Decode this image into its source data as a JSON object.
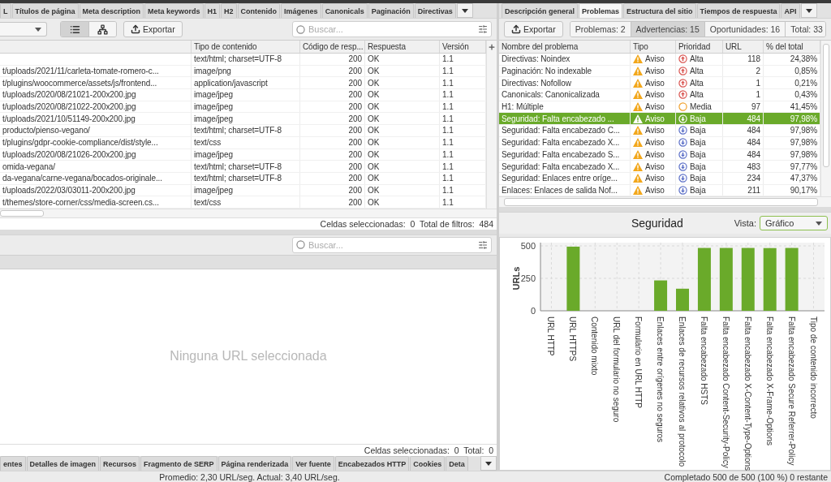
{
  "left_panel": {
    "tabs": [
      {
        "label": "L",
        "selected": false
      },
      {
        "label": "Títulos de página",
        "selected": false
      },
      {
        "label": "Meta description",
        "selected": false
      },
      {
        "label": "Meta keywords",
        "selected": false
      },
      {
        "label": "H1",
        "selected": false
      },
      {
        "label": "H2",
        "selected": false
      },
      {
        "label": "Contenido",
        "selected": false
      },
      {
        "label": "Imágenes",
        "selected": false
      },
      {
        "label": "Canonicals",
        "selected": false
      },
      {
        "label": "Paginación",
        "selected": false
      },
      {
        "label": "Directivas",
        "selected": false
      }
    ],
    "view_buttons": [
      {
        "kind": "list",
        "selected": true
      },
      {
        "kind": "tree",
        "selected": false
      }
    ],
    "export_button": "Exportar",
    "search": {
      "placeholder": "Buscar..."
    },
    "table": {
      "columns": [
        "Tipo de contenido",
        "Código de resp...",
        "Respuesta",
        "Versión"
      ],
      "rows": [
        {
          "content_type": "text/html; charset=UTF-8",
          "code": "200",
          "response": "OK",
          "version": "1.1"
        },
        {
          "column_1": "t/uploads/2021/11/carleta-tomate-romero-c...",
          "content_type": "image/png",
          "code": "200",
          "response": "OK",
          "version": "1.1"
        },
        {
          "column_1": "t/plugins/woocommerce/assets/js/frontend...",
          "content_type": "application/javascript",
          "code": "200",
          "response": "OK",
          "version": "1.1"
        },
        {
          "column_1": "t/uploads/2020/08/21021-200x200.jpg",
          "content_type": "image/jpeg",
          "code": "200",
          "response": "OK",
          "version": "1.1"
        },
        {
          "column_1": "t/uploads/2020/08/21022-200x200.jpg",
          "content_type": "image/jpeg",
          "code": "200",
          "response": "OK",
          "version": "1.1"
        },
        {
          "column_1": "t/uploads/2021/10/51149-200x200.jpg",
          "content_type": "image/jpeg",
          "code": "200",
          "response": "OK",
          "version": "1.1"
        },
        {
          "column_1": "producto/pienso-vegano/",
          "content_type": "text/html; charset=UTF-8",
          "code": "200",
          "response": "OK",
          "version": "1.1"
        },
        {
          "column_1": "t/plugins/gdpr-cookie-compliance/dist/style...",
          "content_type": "text/css",
          "code": "200",
          "response": "OK",
          "version": "1.1"
        },
        {
          "column_1": "t/uploads/2020/08/21026-200x200.jpg",
          "content_type": "image/jpeg",
          "code": "200",
          "response": "OK",
          "version": "1.1"
        },
        {
          "column_1": "omida-vegana/",
          "content_type": "text/html; charset=UTF-8",
          "code": "200",
          "response": "OK",
          "version": "1.1"
        },
        {
          "column_1": "da-vegana/carne-vegana/bocados-originale...",
          "content_type": "text/html; charset=UTF-8",
          "code": "200",
          "response": "OK",
          "version": "1.1"
        },
        {
          "column_1": "t/uploads/2022/03/03011-200x200.jpg",
          "content_type": "image/jpeg",
          "code": "200",
          "response": "OK",
          "version": "1.1"
        },
        {
          "column_1": "t/themes/store-corner/css/media-screen.cs...",
          "content_type": "text/css",
          "code": "200",
          "response": "OK",
          "version": "1.1"
        }
      ]
    },
    "status": "Celdas seleccionadas:  0  Total de filtros:  484"
  },
  "detail_panel": {
    "search": {
      "placeholder": "Buscar..."
    },
    "empty_message": "Ninguna URL seleccionada",
    "status": "Celdas seleccionadas:  0  Total:  0",
    "tabs": [
      {
        "label": "entes",
        "selected": false
      },
      {
        "label": "Detalles de imagen",
        "selected": false
      },
      {
        "label": "Recursos",
        "selected": false
      },
      {
        "label": "Fragmento de SERP",
        "selected": false
      },
      {
        "label": "Página renderizada",
        "selected": false
      },
      {
        "label": "Ver fuente",
        "selected": false
      },
      {
        "label": "Encabezados HTTP",
        "selected": false
      },
      {
        "label": "Cookies",
        "selected": false
      },
      {
        "label": "Deta",
        "selected": false
      }
    ]
  },
  "right_panel": {
    "tabs": [
      {
        "label": "Descripción general",
        "selected": false
      },
      {
        "label": "Problemas",
        "selected": true
      },
      {
        "label": "Estructura del sitio",
        "selected": false
      },
      {
        "label": "Tiempos de respuesta",
        "selected": false
      },
      {
        "label": "API",
        "selected": false
      }
    ],
    "export_button": "Exportar",
    "filters": [
      {
        "label": "Problemas: 2",
        "selected": false
      },
      {
        "label": "Advertencias: 15",
        "selected": true
      },
      {
        "label": "Oportunidades: 16",
        "selected": false
      },
      {
        "label": "Total: 33",
        "selected": false
      }
    ],
    "table": {
      "columns": [
        "Nombre del problema",
        "Tipo",
        "Prioridad",
        "URL",
        "% del total"
      ],
      "rows": [
        {
          "name": "Directivas: Noindex",
          "type": "Aviso",
          "priority": {
            "kind": "high",
            "label": "Alta"
          },
          "urls": "118",
          "percent": "24,38%",
          "selected": false
        },
        {
          "name": "Paginación: No indexable",
          "type": "Aviso",
          "priority": {
            "kind": "high",
            "label": "Alta"
          },
          "urls": "2",
          "percent": "0,85%",
          "selected": false
        },
        {
          "name": "Directivas: Nofollow",
          "type": "Aviso",
          "priority": {
            "kind": "high",
            "label": "Alta"
          },
          "urls": "1",
          "percent": "0,21%",
          "selected": false
        },
        {
          "name": "Canonicals: Canonicalizada",
          "type": "Aviso",
          "priority": {
            "kind": "high",
            "label": "Alta"
          },
          "urls": "1",
          "percent": "0,43%",
          "selected": false
        },
        {
          "name": "H1: Múltiple",
          "type": "Aviso",
          "priority": {
            "kind": "medium",
            "label": "Media"
          },
          "urls": "97",
          "percent": "41,45%",
          "selected": false
        },
        {
          "name": "Seguridad: Falta encabezado ...",
          "type": "Aviso",
          "priority": {
            "kind": "low",
            "label": "Baja"
          },
          "urls": "484",
          "percent": "97,98%",
          "selected": true
        },
        {
          "name": "Seguridad: Falta encabezado C...",
          "type": "Aviso",
          "priority": {
            "kind": "low",
            "label": "Baja"
          },
          "urls": "484",
          "percent": "97,98%",
          "selected": false
        },
        {
          "name": "Seguridad: Falta encabezado X...",
          "type": "Aviso",
          "priority": {
            "kind": "low",
            "label": "Baja"
          },
          "urls": "484",
          "percent": "97,98%",
          "selected": false
        },
        {
          "name": "Seguridad: Falta encabezado S...",
          "type": "Aviso",
          "priority": {
            "kind": "low",
            "label": "Baja"
          },
          "urls": "484",
          "percent": "97,98%",
          "selected": false
        },
        {
          "name": "Seguridad: Falta encabezado X...",
          "type": "Aviso",
          "priority": {
            "kind": "low",
            "label": "Baja"
          },
          "urls": "483",
          "percent": "97,77%",
          "selected": false
        },
        {
          "name": "Seguridad: Enlaces entre oríge...",
          "type": "Aviso",
          "priority": {
            "kind": "low",
            "label": "Baja"
          },
          "urls": "234",
          "percent": "47,37%",
          "selected": false
        },
        {
          "name": "Enlaces: Enlaces de salida Nof...",
          "type": "Aviso",
          "priority": {
            "kind": "low",
            "label": "Baja"
          },
          "urls": "211",
          "percent": "90,17%",
          "selected": false
        }
      ]
    },
    "chart_header": {
      "title": "Seguridad",
      "view_label": "Vista:",
      "view_value": "Gráfico"
    },
    "chart_data": {
      "type": "bar",
      "ylabel": "URLs",
      "categories": [
        "URL HTTP",
        "URL HTTPS",
        "Contenido mixto",
        "URL del formulario no seguro",
        "Formulario en URL HTTP",
        "Enlaces entre orígenes no seguros",
        "Enlaces de recursos relativos al protocolo",
        "Falta encabezado HSTS",
        "Falta encabezado Content-Security-Policy",
        "Falta encabezado X-Content-Type-Options",
        "Falta encabezado X-Frame-Options",
        "Falta encabezado Secure Referrer-Policy",
        "Tipo de contenido incorrecto"
      ],
      "series": [
        {
          "color": "#6aaa2a",
          "values": [
            0,
            494,
            0,
            0,
            0,
            234,
            170,
            484,
            484,
            484,
            483,
            484,
            0
          ]
        }
      ],
      "ylim": [
        0,
        500
      ],
      "yticks": [
        0,
        250,
        500
      ],
      "grid": true
    }
  },
  "status_bar": {
    "left": "Promedio: 2,30 URL/seg. Actual: 3,40 URL/seg.",
    "right": "Completado 500 de 500 (100 %) 0 restante"
  }
}
